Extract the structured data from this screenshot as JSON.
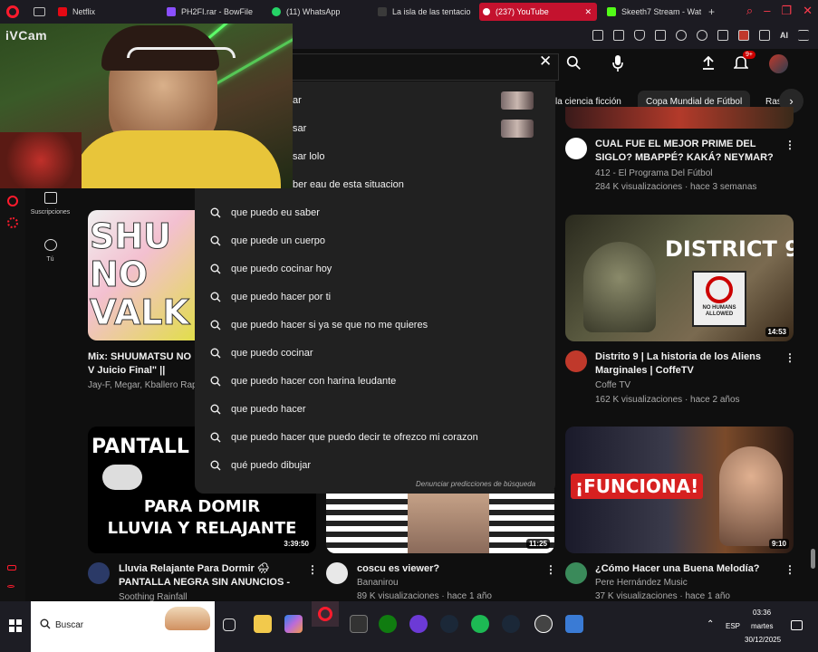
{
  "browser": {
    "tabs": [
      {
        "label": "Netflix",
        "color": "#e50914"
      },
      {
        "label": "PH2FI.rar - BowFile",
        "color": "#8a4fff"
      },
      {
        "label": "(11) WhatsApp",
        "color": "#25d366"
      },
      {
        "label": "La isla de las tentacio",
        "color": "#3a3a3a"
      },
      {
        "label": "(237) YouTube",
        "color": "#ff0000"
      },
      {
        "label": "Skeeth7 Stream - Wat",
        "color": "#53fc18"
      }
    ],
    "ai_label": "AI"
  },
  "webcam": {
    "label": "iVCam"
  },
  "youtube": {
    "notifications_badge": "9+",
    "sidebar": [
      {
        "label": "Suscripciones"
      },
      {
        "label": "Tú"
      }
    ],
    "chips": [
      "la ciencia ficción",
      "Copa Mundial de Fútbol",
      "Ras"
    ],
    "suggestions": [
      "que puedo pagar",
      "que puedo pasar",
      "que puedo pasar lolo",
      "que puedo saber eau de esta situacion",
      "que puedo eu saber",
      "que puede un cuerpo",
      "que puedo cocinar hoy",
      "que puedo hacer por ti",
      "que puedo hacer si ya se que no me quieres",
      "que puedo cocinar",
      "que puedo hacer con harina leudante",
      "que puedo hacer",
      "que puedo hacer que puedo decir te ofrezco mi corazon",
      "qué puedo dibujar"
    ],
    "visible_partial_suggestions": [
      "ar",
      "sar",
      "sar lolo",
      "ber eau de esta situacion"
    ],
    "report_text": "Denunciar predicciones de búsqueda",
    "videos": [
      {
        "title": "CUAL FUE EL MEJOR PRIME DEL SIGLO? MBAPPÉ? KAKÁ? NEYMAR? - ...",
        "channel": "412 - El Programa Del Fútbol",
        "meta": "284 K visualizaciones · hace 3 semanas",
        "avatar_color": "#ffffff"
      },
      {
        "title": "Distrito 9 | La historia de los Aliens Marginales | CoffeTV",
        "channel": "Coffe TV",
        "meta": "162 K visualizaciones · hace 2 años",
        "duration": "14:53",
        "thumb_text": "DISTRICT 9",
        "sign_text": "NO HUMANS ALLOWED",
        "avatar_color": "#c0392b"
      },
      {
        "title": "Mix: SHUUMATSU NO V Juicio Final\" || RECORD",
        "channel": "Jay-F, Megar, Kballero Rap",
        "thumb_text": "SHU NO VALK"
      },
      {
        "title": "Lluvia Relajante Para Dormir 🌧 PANTALLA NEGRA SIN ANUNCIOS - ...",
        "channel": "Soothing Rainfall",
        "duration": "3:39:50",
        "thumb_text_1": "PANTALL",
        "thumb_text_2": "PARA DOMIR",
        "thumb_text_3": "LLUVIA Y RELAJANTE",
        "avatar_color": "#2b3a67"
      },
      {
        "title": "coscu es viewer?",
        "channel": "Bananirou",
        "meta": "89 K visualizaciones · hace 1 año",
        "duration": "11:25",
        "avatar_color": "#e8e8e8"
      },
      {
        "title": "¿Cómo Hacer una Buena Melodía?",
        "channel": "Pere Hernández Music",
        "meta": "37 K visualizaciones · hace 1 año",
        "duration": "9:10",
        "thumb_text": "¡FUNCIONA!",
        "avatar_color": "#3a8a5a"
      }
    ]
  },
  "taskbar": {
    "search_label": "Buscar",
    "lang": "ESP",
    "time": "03:36",
    "day": "martes",
    "date": "30/12/2025"
  }
}
